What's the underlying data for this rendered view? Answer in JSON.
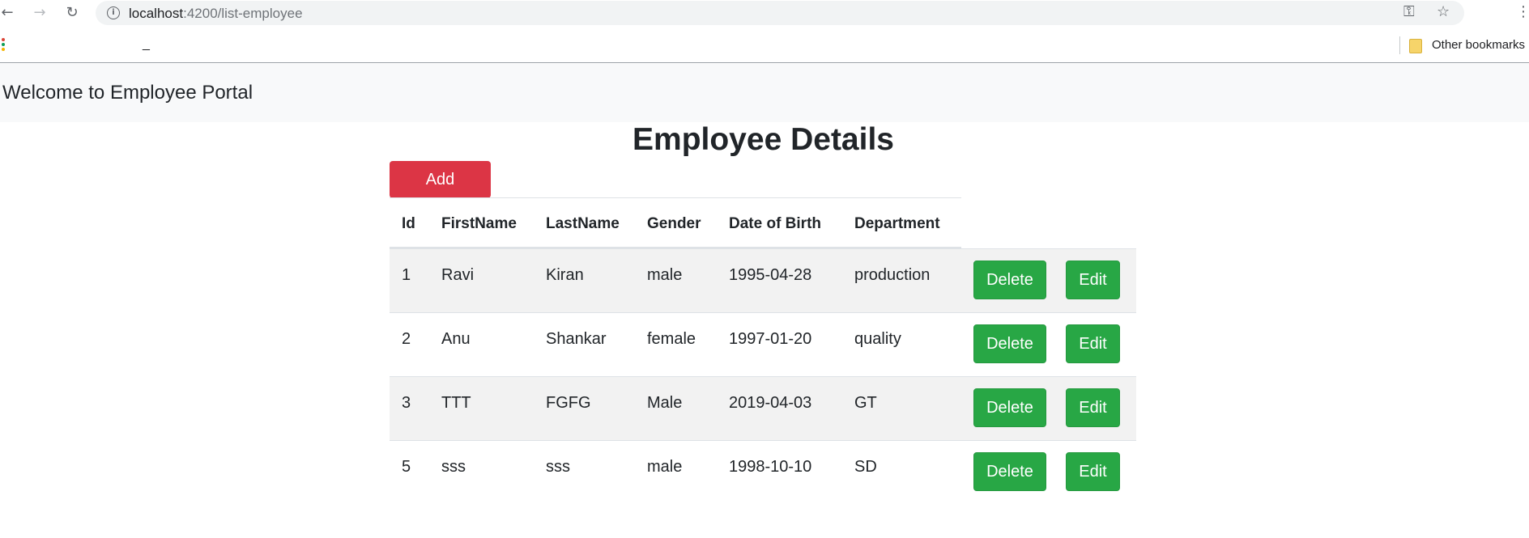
{
  "browser": {
    "url_host": "localhost",
    "url_path": ":4200/list-employee",
    "back_icon": "←",
    "forward_icon": "→",
    "reload_icon": "↻",
    "info_icon": "i",
    "key_icon": "⚿",
    "star_icon": "☆",
    "menu_icon": "⋮",
    "bookmark_underscore": "_",
    "other_bookmarks": "Other bookmarks"
  },
  "navbar": {
    "brand": "Welcome to Employee Portal"
  },
  "page": {
    "title": "Employee Details",
    "add_label": "Add"
  },
  "table": {
    "columns": [
      "Id",
      "FirstName",
      "LastName",
      "Gender",
      "Date of Birth",
      "Department"
    ],
    "rows": [
      [
        "1",
        "Ravi",
        "Kiran",
        "male",
        "1995-04-28",
        "production"
      ],
      [
        "2",
        "Anu",
        "Shankar",
        "female",
        "1997-01-20",
        "quality"
      ],
      [
        "3",
        "TTT",
        "FGFG",
        "Male",
        "2019-04-03",
        "GT"
      ],
      [
        "5",
        "sss",
        "sss",
        "male",
        "1998-10-10",
        "SD"
      ]
    ],
    "delete_label": "Delete",
    "edit_label": "Edit"
  },
  "colors": {
    "danger": "#dc3545",
    "success": "#28a745",
    "navbar_bg": "#f8f9fa",
    "stripe": "#f2f2f2",
    "text": "#212529"
  }
}
